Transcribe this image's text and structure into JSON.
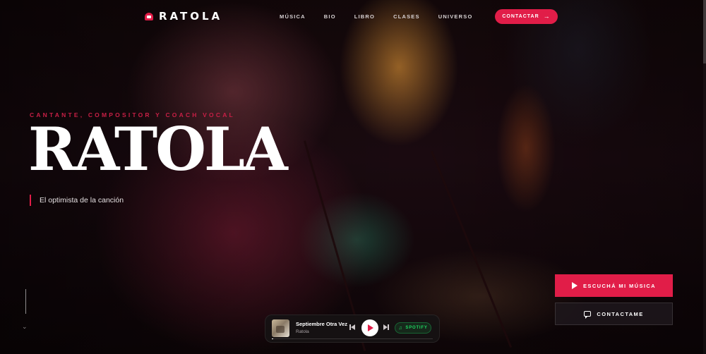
{
  "brand": {
    "name": "RATOLA",
    "accent": "#e11d48"
  },
  "nav": {
    "links": [
      "MÚSICA",
      "BIO",
      "LIBRO",
      "CLASES",
      "UNIVERSO"
    ],
    "contact_label": "CONTACTAR"
  },
  "hero": {
    "subtitle": "CANTANTE, COMPOSITOR Y COACH VOCAL",
    "title": "RATOLA",
    "tagline": "El optimista de la canción"
  },
  "cta": {
    "primary_label": "ESCUCHÁ MI MÚSICA",
    "secondary_label": "CONTACTAME"
  },
  "player": {
    "track_title": "Septiembre Otra Vez",
    "artist": "Ratola",
    "service_label": "SPOTIFY",
    "service_color": "#1ed760",
    "progress": 0.01
  }
}
